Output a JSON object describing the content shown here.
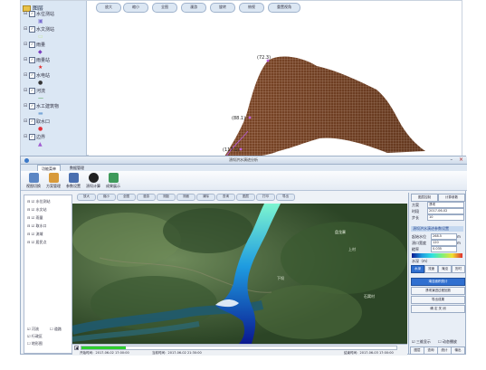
{
  "top_window": {
    "tree_root": "图层",
    "layers": [
      {
        "label": "水位测站",
        "symbol": "▣",
        "color": "#7a6fd0"
      },
      {
        "label": "水文测站",
        "symbol": "▭",
        "color": "#c8e69a"
      },
      {
        "label": "雨量",
        "symbol": "◆",
        "color": "#7b3fbf"
      },
      {
        "label": "雨量站",
        "symbol": "★",
        "color": "#e02a2a"
      },
      {
        "label": "水电站",
        "symbol": "●",
        "color": "#333333"
      },
      {
        "label": "河流",
        "symbol": "—",
        "color": "#3a9a3a"
      },
      {
        "label": "水工建筑物",
        "symbol": "▬",
        "color": "#7aa7d8"
      },
      {
        "label": "取水口",
        "symbol": "●",
        "color": "#e0303a"
      },
      {
        "label": "边界",
        "symbol": "▲",
        "color": "#a05ad0"
      }
    ],
    "toolbar": [
      "放大",
      "缩小",
      "全图",
      "漫游",
      "旋转",
      "俯视",
      "重置视角"
    ],
    "annotations": [
      "(72.3)",
      "(88.1)",
      "(117.1)"
    ]
  },
  "bottom_window": {
    "title": "溃坝洪水演进分析",
    "ribbon_tabs": [
      "功能菜单",
      "数据管理"
    ],
    "ribbon_buttons": [
      {
        "label": "视图切换",
        "color": "#5b86c4"
      },
      {
        "label": "方案管理",
        "color": "#d89a3a"
      },
      {
        "label": "参数设置",
        "color": "#4a6fb0"
      },
      {
        "label": "溃坝计算",
        "color": "#222222"
      },
      {
        "label": "成果展示",
        "color": "#3f9a5a"
      }
    ],
    "left_panel": {
      "layers": [
        "水位测站",
        "水文站",
        "雨量",
        "取水口",
        "流域",
        "居民点"
      ],
      "checkboxes": [
        "河流",
        "道路",
        "行政区",
        "地形图"
      ]
    },
    "map_toolbar": [
      "放大",
      "缩小",
      "全图",
      "漫游",
      "测距",
      "测面",
      "清除",
      "查询",
      "图层",
      "打印",
      "导出"
    ],
    "map_labels": [
      "盘龙寨",
      "上村",
      "石窝村",
      "下坝"
    ],
    "status": {
      "start_label": "开始时间：",
      "start_time": "2017-06-02 17:00:00",
      "current_label": "当前时间：",
      "current_time": "2017-06-02 21:30:00",
      "end_label": "结束时间：",
      "end_time": "2017-06-03 17:00:00",
      "progress_fraction": 0.14
    },
    "right_panel": {
      "tabs": [
        "图层控制",
        "计算参数"
      ],
      "fields": [
        {
          "label": "方案",
          "value": "溃坝"
        },
        {
          "label": "时段",
          "value": "2017-06-02"
        },
        {
          "label": "步长",
          "value": "10"
        }
      ],
      "header": "溃坝洪水演进参数设置",
      "param_rows": [
        {
          "label": "起始水位",
          "value": "268.5",
          "unit": "m"
        },
        {
          "label": "溃口宽度",
          "value": "120",
          "unit": "m"
        },
        {
          "label": "糙率",
          "value": "0.035",
          "unit": ""
        }
      ],
      "legend_caption": "水深（m）",
      "mode_buttons": [
        "水深",
        "流速",
        "淹没",
        "历时"
      ],
      "action_buttons": [
        "淹没面积统计",
        "溃坝演进过程回放",
        "导出成果",
        "确 定 关 闭"
      ],
      "footer_options": [
        "三维显示",
        "动态播放"
      ],
      "footer_tabs": [
        "图层",
        "查询",
        "统计",
        "输出"
      ]
    }
  }
}
